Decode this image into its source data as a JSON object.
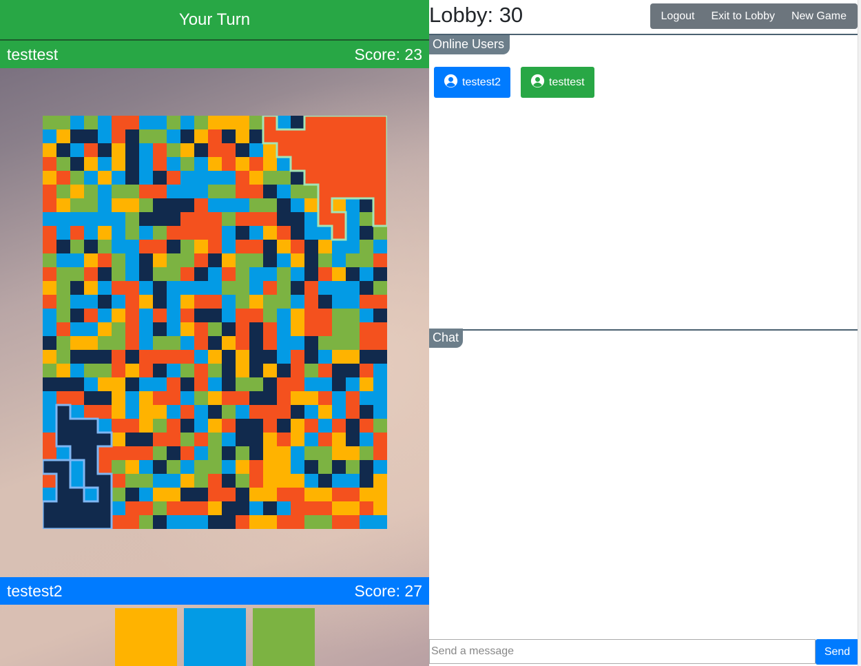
{
  "game": {
    "turn_banner": "Your Turn",
    "player1": {
      "name": "testtest",
      "score_text": "Score: 23",
      "color": "#28a745"
    },
    "player2": {
      "name": "testest2",
      "score_text": "Score: 27",
      "color": "#007bff"
    },
    "board": {
      "cols": 25,
      "rows": 30,
      "palette": {
        "O": "#f4511e",
        "Y": "#ffb300",
        "B": "#039be5",
        "G": "#7cb342",
        "N": "#112a4d"
      },
      "grid": [
        "GGBGBOOBBGBGYYYGOBNOOOOOO",
        "BYNNBONGGBNYONYNOOOOOOOOO",
        "YNBONYNBOGYNOONBYOOOOOOOO",
        "OGNYBYNBOBGBYOYOYBOOOOOOO",
        "YOGBYBNBNOBBBBOYGGNOOOOOO",
        "OGYGBGGOOBBBGGOONBGGOOOOO",
        "OYGGBYYGNNNOBBBGGNBYOYBNO",
        "BBBBBBGNNNOOOGOOONNBOOBGO",
        "OBOBYBGBGOOOOBNBYONBBOBNG",
        "ONGNGBBOONGYOBOONYONYBBGB",
        "GBBYOGBNYGGONYGGNBYNGBGGO",
        "OGGONGBNGGONBOGBBGBNOYNBN",
        "YGNYBOOBNBBBBGGBOGNOBBBNG",
        "OGBBNBOYNBYOOBGYGGBONBBOO",
        "BGNOBYOBOBONNBOOGBYOOGGBN",
        "BOBBYGOBNBYOGNONOBYOOGGOO",
        "NGYYGGOBGGBONYONOBBNGGGOO",
        "YGNNNONOOOOBYNYNNBONBYYNN",
        "GYBGGOYONBGOGNYNYNOGONNOB",
        "NNNBYYNBBONOBNGGNOOBBNBYB",
        "BOONNYBYOOBGYOONNOYYOBOBB",
        "BNBOOYBYYBOBNGBOOONBYBONB",
        "BNNNBOOYGONBYONNONYOBONOG",
        "ONNNNYNNOOGOGBNNYOYBOYNBO",
        "OBNNOOOOGNOBGNGNYYBGGYYGO",
        "NNBNOGYBNGBGGBYOYYBNGNGNB",
        "ONBNNOGGBBYGONGOYYYBNBBNY",
        "BNNBNGNBYYNNOONYYOOYYOOYY",
        "NNNNNBOOGOOOYNNBNBOOOYYOY",
        "NNNNNOOGNBBBNNOYYOOGGOOBB"
      ],
      "territories": [
        {
          "owner": "player1",
          "color": "#a3e4b6"
        },
        {
          "owner": "player2",
          "color": "#7fb6f2"
        }
      ]
    },
    "color_choices": [
      {
        "name": "yellow",
        "color": "#ffb300"
      },
      {
        "name": "light-blue",
        "color": "#039be5"
      },
      {
        "name": "green",
        "color": "#7cb342"
      }
    ]
  },
  "lobby": {
    "title": "Lobby: 30",
    "nav": {
      "logout": "Logout",
      "exit": "Exit to Lobby",
      "new_game": "New Game"
    },
    "online_users_label": "Online Users",
    "users": [
      {
        "name": "testest2"
      },
      {
        "name": "testtest"
      }
    ],
    "chat_label": "Chat",
    "message_placeholder": "Send a message",
    "send_label": "Send"
  }
}
